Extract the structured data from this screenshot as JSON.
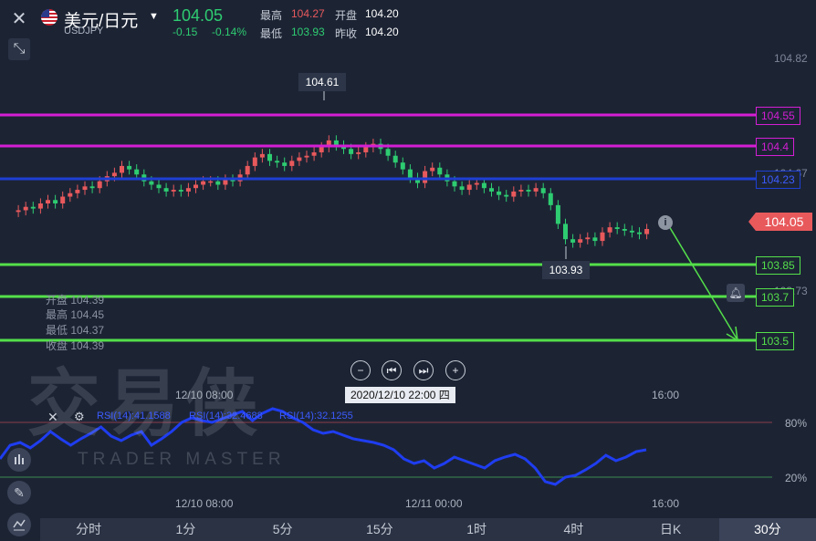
{
  "header": {
    "pair": "美元/日元",
    "symbol": "USDJPY",
    "price": "104.05",
    "change": "-0.15",
    "change_pct": "-0.14%",
    "stats": [
      {
        "label": "最高",
        "value": "104.27",
        "color": "#e8595c"
      },
      {
        "label": "开盘",
        "value": "104.20",
        "color": "#ffffff"
      },
      {
        "label": "最低",
        "value": "103.93",
        "color": "#2ecc71"
      },
      {
        "label": "昨收",
        "value": "104.20",
        "color": "#ffffff"
      }
    ]
  },
  "price_axis": {
    "top": "104.82",
    "label_104_67": "104.67",
    "label_103_73": "103.73",
    "current": "104.05"
  },
  "level_lines": [
    {
      "label": "104.55",
      "color": "#d41ed4"
    },
    {
      "label": "104.4",
      "color": "#d41ed4"
    },
    {
      "label": "104.23",
      "color": "#1e3fd4"
    },
    {
      "label": "103.85",
      "color": "#54e04a"
    },
    {
      "label": "103.7",
      "color": "#54e04a"
    },
    {
      "label": "103.5",
      "color": "#54e04a"
    }
  ],
  "callouts": {
    "high": "104.61",
    "low": "103.93"
  },
  "ohlc_panel": [
    {
      "label": "开盘",
      "value": "104.39"
    },
    {
      "label": "最高",
      "value": "104.45"
    },
    {
      "label": "最低",
      "value": "104.37"
    },
    {
      "label": "收盘",
      "value": "104.39"
    }
  ],
  "time_axis_main": [
    "12/10 08:00",
    "16:00"
  ],
  "crosshair_time": "2020/12/10 22:00 四",
  "rsi_panel": {
    "legend": [
      "RSI(14):41.1588",
      "RSI(14):32.4688",
      "RSI(14):32.1255"
    ],
    "level_80": "80%",
    "level_20": "20%"
  },
  "time_axis_rsi": [
    "12/10 08:00",
    "12/11 00:00",
    "16:00"
  ],
  "watermark": {
    "cn": "交易侠",
    "en": "TRADER MASTER"
  },
  "tabs": [
    "分时",
    "1分",
    "5分",
    "15分",
    "1时",
    "4时",
    "日K",
    "30分"
  ],
  "active_tab": "30分",
  "colors": {
    "up": "#e8595c",
    "down": "#2ecc71",
    "background": "#1c2434",
    "rsi_line": "#1f3df0",
    "current_price_tag": "#e8595c"
  }
}
